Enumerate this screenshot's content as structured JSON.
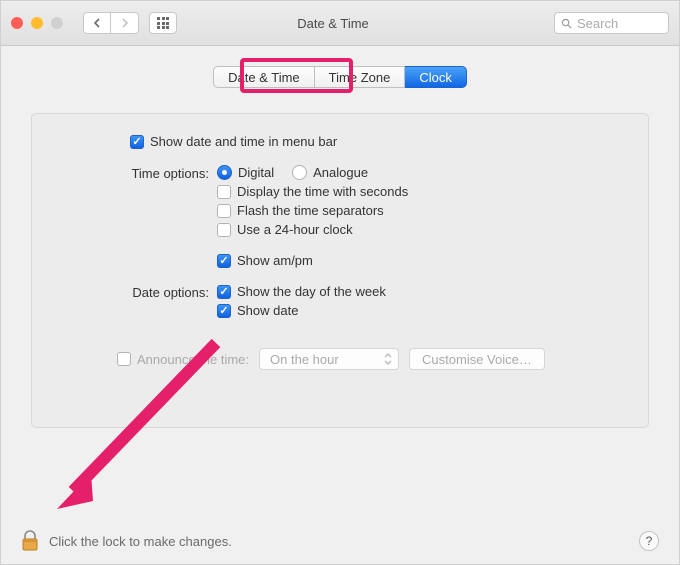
{
  "window": {
    "title": "Date & Time"
  },
  "search": {
    "placeholder": "Search"
  },
  "tabs": {
    "date_time": "Date & Time",
    "time_zone": "Time Zone",
    "clock": "Clock"
  },
  "options": {
    "show_in_menubar": "Show date and time in menu bar",
    "time_label": "Time options:",
    "digital": "Digital",
    "analogue": "Analogue",
    "display_seconds": "Display the time with seconds",
    "flash_separators": "Flash the time separators",
    "use_24h": "Use a 24-hour clock",
    "show_ampm": "Show am/pm",
    "date_label": "Date options:",
    "show_dow": "Show the day of the week",
    "show_date": "Show date",
    "announce": "Announce the time:",
    "interval": "On the hour",
    "customise": "Customise Voice…"
  },
  "footer": {
    "lock_text": "Click the lock to make changes."
  }
}
